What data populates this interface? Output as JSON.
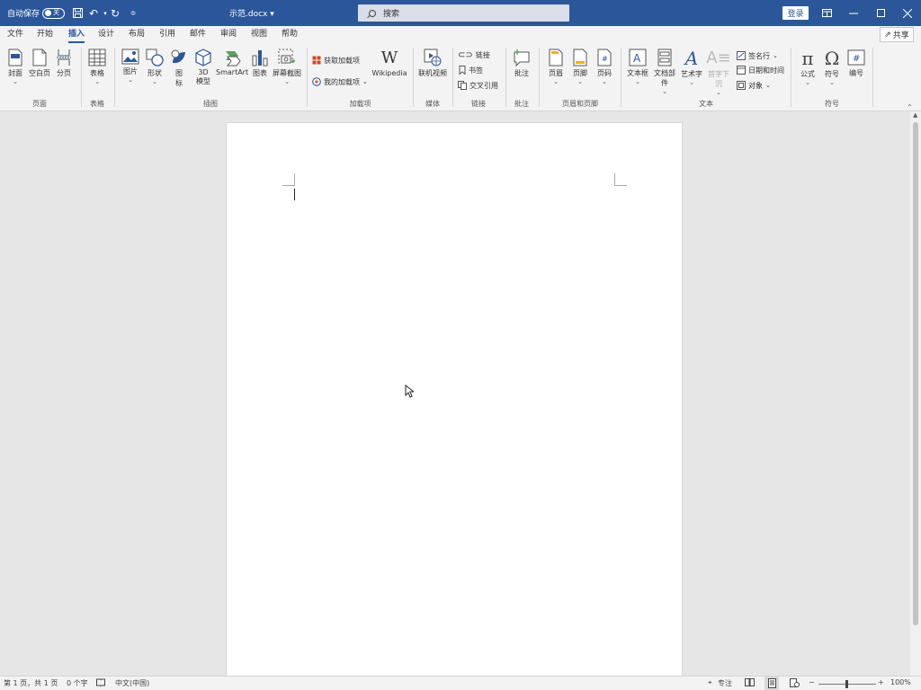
{
  "titlebar": {
    "autosave_label": "自动保存",
    "autosave_state": "关",
    "doc_title": "示范.docx ▾",
    "search_placeholder": "搜索",
    "login_label": "登录"
  },
  "tabs": [
    "文件",
    "开始",
    "插入",
    "设计",
    "布局",
    "引用",
    "邮件",
    "审阅",
    "视图",
    "帮助"
  ],
  "active_tab": "插入",
  "share_label": "共享",
  "ribbon": {
    "pages": {
      "cover": "封面",
      "blank": "空白页",
      "break": "分页",
      "group": "页面"
    },
    "tables": {
      "table": "表格",
      "group": "表格"
    },
    "illustrations": {
      "picture": "图片",
      "shapes": "形状",
      "icons_1": "图",
      "icons_2": "标",
      "model_1": "3D",
      "model_2": "模型",
      "smartart": "SmartArt",
      "chart": "图表",
      "screenshot": "屏幕截图",
      "group": "插图"
    },
    "addins": {
      "get": "获取加载项",
      "my": "我的加载项",
      "wikipedia": "Wikipedia",
      "group": "加载项"
    },
    "media": {
      "online_video": "联机视频",
      "group": "媒体"
    },
    "links": {
      "link": "链接",
      "bookmark": "书签",
      "cross_ref": "交叉引用",
      "group": "链接"
    },
    "comments": {
      "comment": "批注",
      "group": "批注"
    },
    "header_footer": {
      "header": "页眉",
      "footer": "页脚",
      "page_number": "页码",
      "group": "页眉和页脚"
    },
    "text": {
      "textbox": "文本框",
      "quick_parts": "文档部件",
      "wordart": "艺术字",
      "dropcap": "首字下沉",
      "signature": "签名行",
      "datetime": "日期和时间",
      "object": "对象",
      "group": "文本"
    },
    "symbols": {
      "equation": "公式",
      "symbol": "符号",
      "number": "编号",
      "group": "符号"
    }
  },
  "status": {
    "page": "第 1 页，共 1 页",
    "words": "0 个字",
    "language": "中文(中国)",
    "focus": "专注",
    "zoom": "100%"
  },
  "colors": {
    "accent": "#2b579a",
    "ribbon_bg": "#f3f3f3",
    "canvas_bg": "#e6e6e6"
  }
}
